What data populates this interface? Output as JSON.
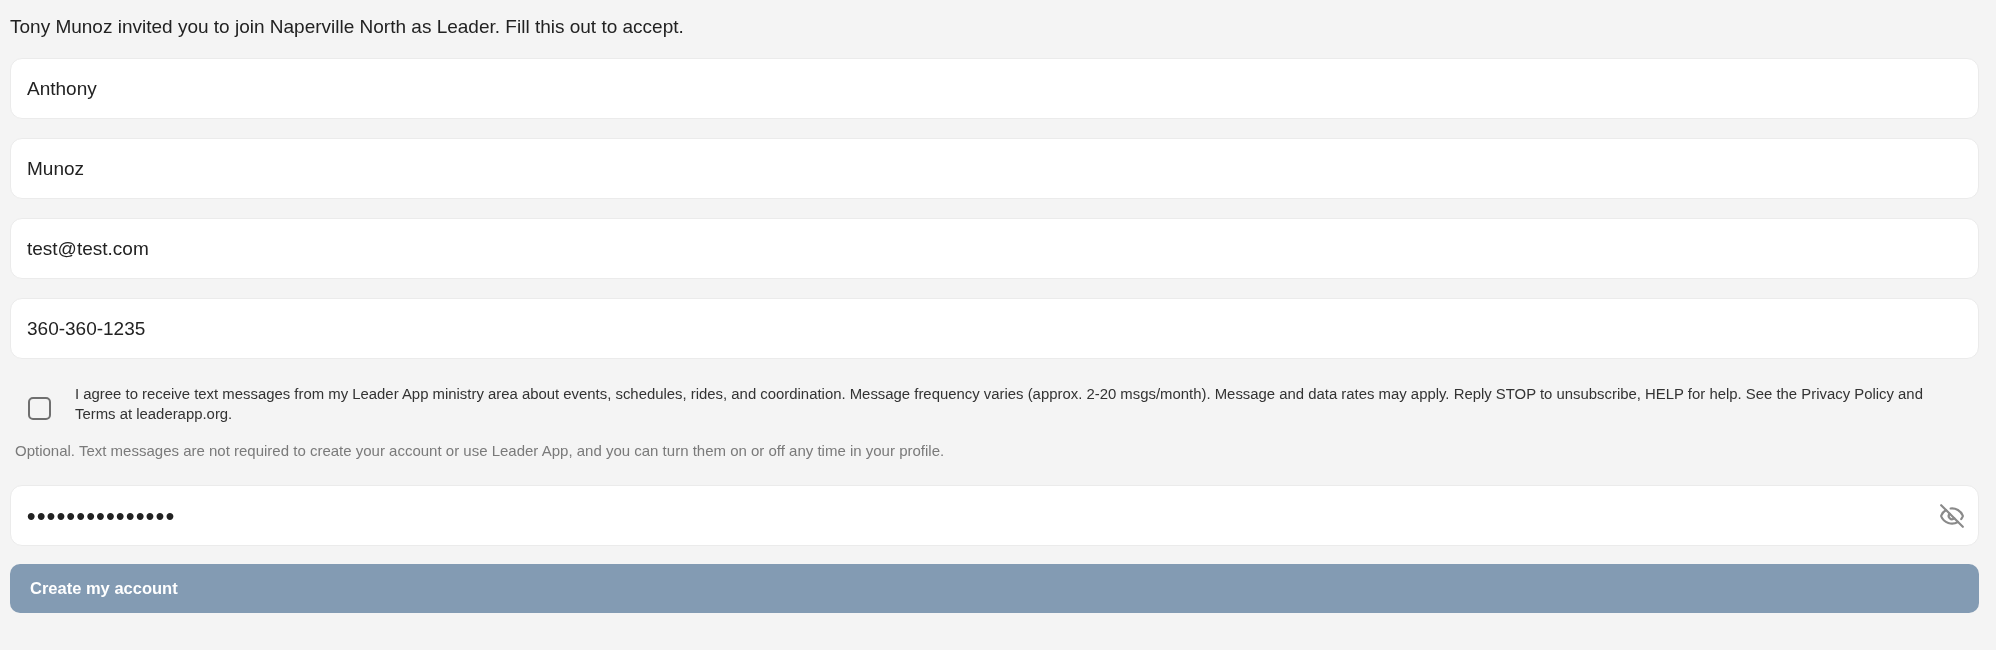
{
  "invitation": "Tony Munoz invited you to join Naperville North as Leader. Fill this out to accept.",
  "fields": [
    {
      "value": "Anthony"
    },
    {
      "value": "Munoz"
    },
    {
      "value": "test@test.com"
    },
    {
      "value": "360-360-1235"
    }
  ],
  "sms_consent": {
    "checked": false,
    "label": "I agree to receive text messages from my Leader App ministry area about events, schedules, rides, and coordination. Message frequency varies (approx. 2-20 msgs/month). Message and data rates may apply. Reply STOP to unsubscribe, HELP for help. See the Privacy Policy and Terms at leaderapp.org.",
    "note": "Optional. Text messages are not required to create your account or use Leader App, and you can turn them on or off any time in your profile."
  },
  "password": {
    "value": "•••••••••••••••",
    "visible": false
  },
  "submit_button": {
    "label": "Create my account",
    "disabled": true
  }
}
